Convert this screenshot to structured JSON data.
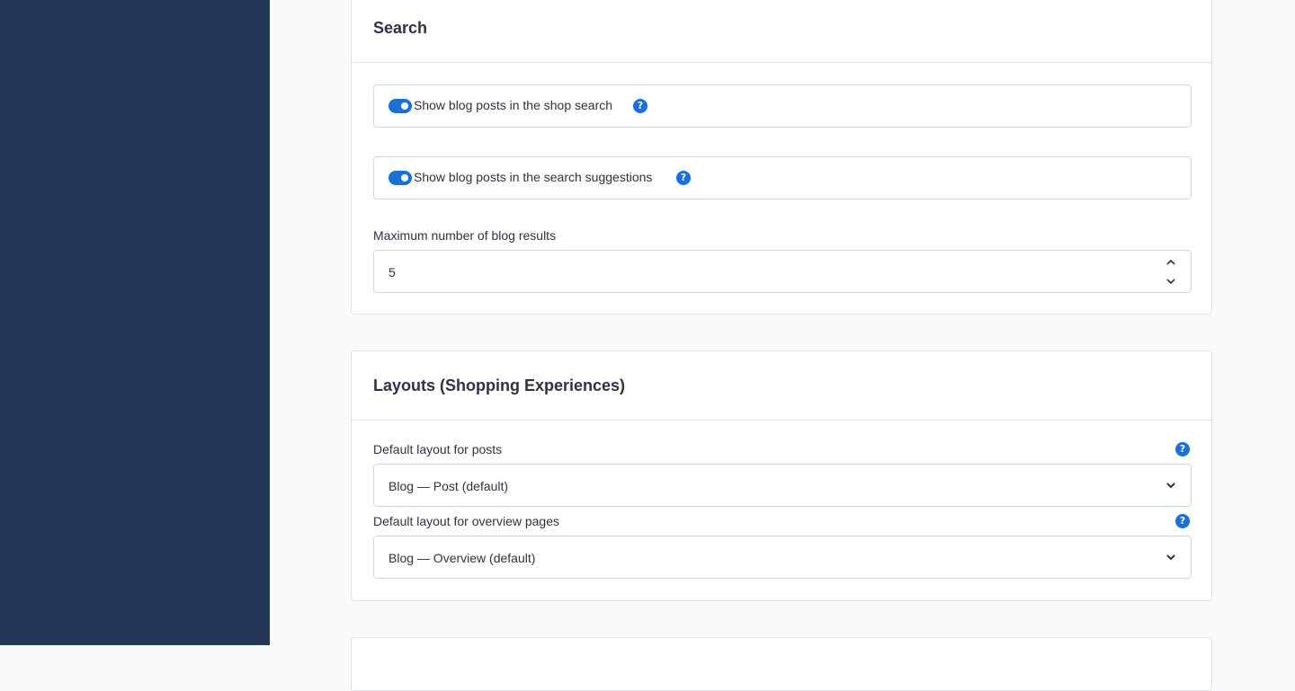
{
  "search": {
    "title": "Search",
    "toggle_shop_search": {
      "label": "Show blog posts in the shop search",
      "enabled": true
    },
    "toggle_suggestions": {
      "label": "Show blog posts in the search suggestions",
      "enabled": true
    },
    "max_results": {
      "label": "Maximum number of blog results",
      "value": "5"
    }
  },
  "layouts": {
    "title": "Layouts (Shopping Experiences)",
    "post_layout": {
      "label": "Default layout for posts",
      "value": "Blog — Post (default)"
    },
    "overview_layout": {
      "label": "Default layout for overview pages",
      "value": "Blog — Overview (default)"
    }
  },
  "icons": {
    "help": "?"
  },
  "colors": {
    "sidebar": "#243756",
    "accent": "#1a6fd9",
    "background": "#f9fafc"
  }
}
